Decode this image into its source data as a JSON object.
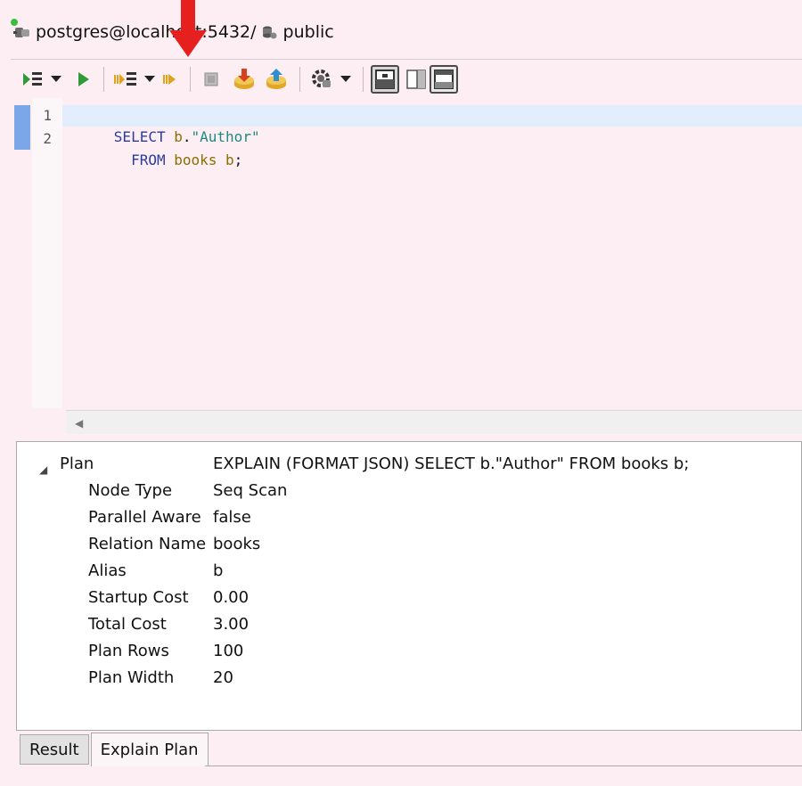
{
  "connection": {
    "label": "postgres@localhost:5432/",
    "schema": "public"
  },
  "toolbar": {
    "buttons": [
      {
        "name": "execute-statement-button",
        "icon": "execute-script-icon"
      },
      {
        "name": "execute-dropdown-button",
        "icon": "chevron-down-icon"
      },
      {
        "name": "run-button",
        "icon": "play-icon"
      },
      {
        "name": "explain-plan-button",
        "icon": "explain-icon"
      },
      {
        "name": "explain-dropdown-button",
        "icon": "chevron-down-icon"
      },
      {
        "name": "explain-analyze-button",
        "icon": "explain-analyze-icon"
      },
      {
        "name": "stop-button",
        "icon": "stop-icon"
      },
      {
        "name": "import-button",
        "icon": "import-icon"
      },
      {
        "name": "export-button",
        "icon": "export-icon"
      },
      {
        "name": "transaction-button",
        "icon": "gear-icon"
      },
      {
        "name": "transaction-dropdown-button",
        "icon": "chevron-down-icon"
      },
      {
        "name": "layout-horizontal-button",
        "icon": "layout-horizontal-icon"
      },
      {
        "name": "layout-vertical-button",
        "icon": "layout-vertical-icon"
      },
      {
        "name": "layout-maximize-button",
        "icon": "layout-maximize-icon"
      }
    ],
    "accent_color": "#2e9a38"
  },
  "editor": {
    "line_numbers": [
      "1",
      "2"
    ],
    "lines": [
      {
        "tokens": [
          {
            "t": "SELECT ",
            "c": "kw"
          },
          {
            "t": "b",
            "c": "ident"
          },
          {
            "t": ".",
            "c": "punct"
          },
          {
            "t": "\"Author\"",
            "c": "str"
          }
        ]
      },
      {
        "tokens": [
          {
            "t": "  FROM ",
            "c": "kw"
          },
          {
            "t": "books",
            "c": "ident"
          },
          {
            "t": " b",
            "c": "ident"
          },
          {
            "t": ";",
            "c": "punct"
          }
        ]
      }
    ]
  },
  "plan": {
    "root_key": "Plan",
    "root_value": "EXPLAIN (FORMAT JSON) SELECT b.\"Author\"  FROM books b;",
    "rows": [
      {
        "key": "Node Type",
        "value": "Seq Scan"
      },
      {
        "key": "Parallel Aware",
        "value": "false"
      },
      {
        "key": "Relation Name",
        "value": "books"
      },
      {
        "key": "Alias",
        "value": "b"
      },
      {
        "key": "Startup Cost",
        "value": "0.00"
      },
      {
        "key": "Total Cost",
        "value": "3.00"
      },
      {
        "key": "Plan Rows",
        "value": "100"
      },
      {
        "key": "Plan Width",
        "value": "20"
      }
    ]
  },
  "tabs": [
    {
      "label": "Result",
      "active": false
    },
    {
      "label": "Explain Plan",
      "active": true
    }
  ],
  "annotation": {
    "color": "#e5201f",
    "icon": "red-down-arrow"
  }
}
